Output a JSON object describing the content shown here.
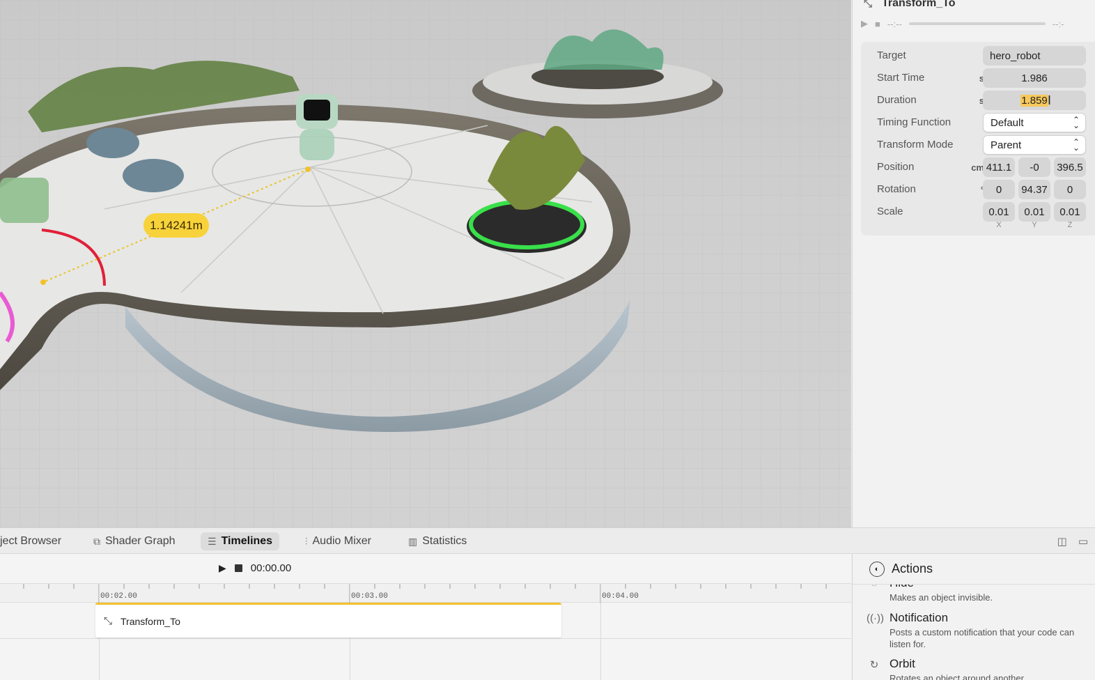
{
  "viewport": {
    "measurement_label": "1.14241m"
  },
  "inspector": {
    "title": "Transform_To",
    "player": {
      "time_current": "--:--",
      "time_end": "--:-"
    },
    "properties": {
      "target": {
        "label": "Target",
        "value": "hero_robot"
      },
      "start_time": {
        "label": "Start Time",
        "unit": "s",
        "value": "1.986"
      },
      "duration": {
        "label": "Duration",
        "unit": "s",
        "value": "1.859"
      },
      "timing_function": {
        "label": "Timing Function",
        "value": "Default"
      },
      "transform_mode": {
        "label": "Transform Mode",
        "value": "Parent"
      },
      "position": {
        "label": "Position",
        "unit": "cm",
        "x": "411.1",
        "y": "-0",
        "z": "396.5"
      },
      "rotation": {
        "label": "Rotation",
        "unit": "°",
        "x": "0",
        "y": "94.37",
        "z": "0"
      },
      "scale": {
        "label": "Scale",
        "x": "0.01",
        "y": "0.01",
        "z": "0.01"
      },
      "axis": {
        "x": "X",
        "y": "Y",
        "z": "Z"
      }
    }
  },
  "tabs": [
    {
      "label": "ject Browser",
      "icon": "cube-icon"
    },
    {
      "label": "Shader Graph",
      "icon": "node-graph-icon"
    },
    {
      "label": "Timelines",
      "icon": "timeline-icon",
      "active": true
    },
    {
      "label": "Audio Mixer",
      "icon": "sliders-icon"
    },
    {
      "label": "Statistics",
      "icon": "bar-chart-icon"
    }
  ],
  "timeline": {
    "timecode": "00:00.00",
    "ruler": [
      "00:02.00",
      "00:03.00",
      "00:04.00"
    ],
    "clip_label": "Transform_To"
  },
  "actions": {
    "title": "Actions",
    "items": [
      {
        "name": "Hide",
        "description": "Makes an object invisible.",
        "icon": "eye-slash-icon"
      },
      {
        "name": "Notification",
        "description": "Posts a custom notification that your code can listen for.",
        "icon": "broadcast-icon"
      },
      {
        "name": "Orbit",
        "description": "Rotates an object around another",
        "icon": "orbit-icon"
      }
    ]
  },
  "colors": {
    "accent_yellow": "#f2c12e",
    "measure_label": "#f7d23a",
    "selection": "#f6c85c"
  }
}
